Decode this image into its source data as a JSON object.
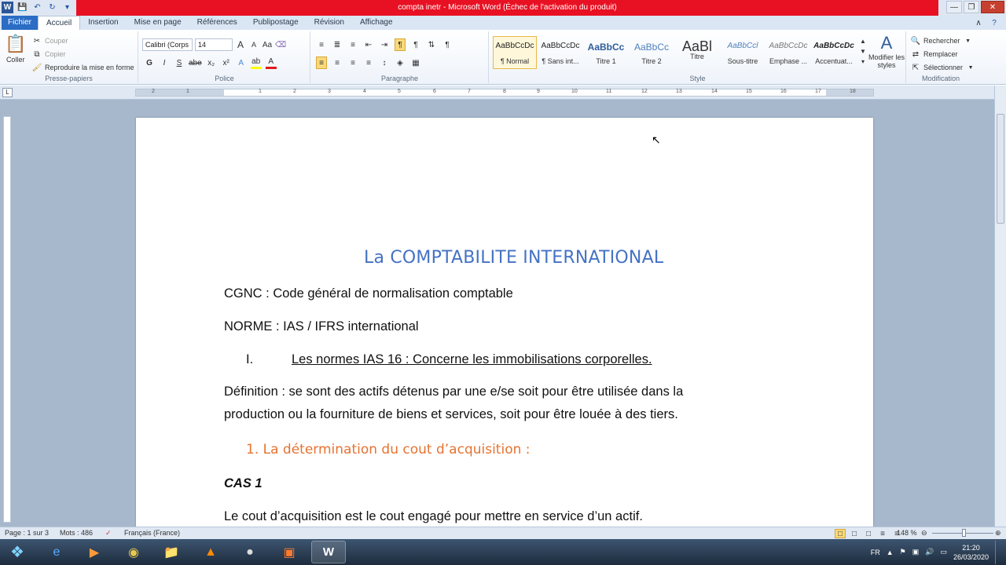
{
  "window": {
    "title": "compta inetr - Microsoft Word (Échec de l'activation du produit)"
  },
  "tabs": [
    "Fichier",
    "Accueil",
    "Insertion",
    "Mise en page",
    "Références",
    "Publipostage",
    "Révision",
    "Affichage"
  ],
  "ribbon": {
    "clipboard": {
      "label": "Presse-papiers",
      "paste": "Coller",
      "cut": "Couper",
      "copy": "Copier",
      "format_painter": "Reproduire la mise en forme"
    },
    "font": {
      "label": "Police",
      "font_name": "Calibri (Corps",
      "font_size": "14",
      "bold": "G",
      "italic": "I",
      "underline": "S",
      "strike": "abe",
      "subscript": "x₂",
      "superscript": "x²",
      "grow": "A",
      "shrink": "A",
      "case": "Aa"
    },
    "paragraph": {
      "label": "Paragraphe",
      "pilcrow": "¶"
    },
    "styles": {
      "label": "Style",
      "items": [
        {
          "preview": "AaBbCcDc",
          "name": "¶ Normal"
        },
        {
          "preview": "AaBbCcDc",
          "name": "¶ Sans int..."
        },
        {
          "preview": "AaBbCc",
          "name": "Titre 1"
        },
        {
          "preview": "AaBbCc",
          "name": "Titre 2"
        },
        {
          "preview": "AaBl",
          "name": "Titre"
        },
        {
          "preview": "AaBbCcl",
          "name": "Sous-titre"
        },
        {
          "preview": "AaBbCcDc",
          "name": "Emphase ..."
        },
        {
          "preview": "AaBbCcDc",
          "name": "Accentuat..."
        }
      ],
      "modify": "Modifier les styles"
    },
    "editing": {
      "label": "Modification",
      "find": "Rechercher",
      "replace": "Remplacer",
      "select": "Sélectionner"
    }
  },
  "ruler_numbers": [
    "2",
    "1",
    "1",
    "2",
    "3",
    "4",
    "5",
    "6",
    "7",
    "8",
    "9",
    "10",
    "11",
    "12",
    "13",
    "14",
    "15",
    "16",
    "17",
    "18"
  ],
  "document": {
    "title": "La COMPTABILITE INTERNATIONAL",
    "line1": "CGNC : Code général de normalisation comptable",
    "line2": "NORME : IAS / IFRS international",
    "list_num": "I.",
    "list_text": "Les normes IAS 16 : Concerne les immobilisations corporelles.",
    "def_line1": "Définition : se sont des actifs détenus par une e/se soit pour  être utilisée dans la",
    "def_line2": "production ou la fourniture de biens et services, soit pour être louée à des tiers.",
    "subheading": "1.  La détermination du cout d’acquisition :",
    "cas": "CAS 1",
    "last_line": "Le cout d’acquisition est le cout engagé pour mettre en service d’un actif."
  },
  "status": {
    "page": "Page : 1 sur 3",
    "words": "Mots : 486",
    "language": "Français (France)",
    "zoom": "148 %"
  },
  "taskbar": {
    "lang": "FR",
    "time": "21:20",
    "date": "26/03/2020"
  }
}
